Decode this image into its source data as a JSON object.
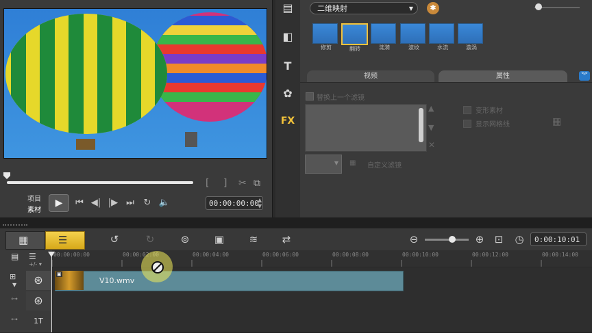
{
  "preview": {
    "timecode": "00:00:00:00",
    "mode_project": "项目",
    "mode_clip": "素材",
    "transport": [
      "play-icon",
      "home-icon",
      "prev-frame-icon",
      "next-frame-icon",
      "end-icon",
      "repeat-icon",
      "volume-icon"
    ],
    "mark_in": "[",
    "mark_out": "]"
  },
  "effects": {
    "category": "二维映射",
    "thumbs": [
      {
        "label": "修剪",
        "selected": false
      },
      {
        "label": "翻转",
        "selected": true
      },
      {
        "label": "涟漪",
        "selected": false
      },
      {
        "label": "波纹",
        "selected": false
      },
      {
        "label": "水流",
        "selected": false
      },
      {
        "label": "漩涡",
        "selected": false
      }
    ],
    "tabs": [
      "视频",
      "属性"
    ],
    "active_tab": "属性",
    "replace_last": "替换上一个滤镜",
    "option_split": "变形素材",
    "option_grid": "显示网格线",
    "custom_filter": "自定义滤镜"
  },
  "toolbar": {
    "timecode": "0:00:10:01"
  },
  "timeline": {
    "ticks": [
      "00:00:00:00",
      "00:00:02:00",
      "00:00:04:00",
      "00:00:06:00",
      "00:00:08:00",
      "00:00:10:00",
      "00:00:12:00",
      "00:00:14:00"
    ],
    "clip_name": "V10.wmv",
    "title_track_label": "1T"
  },
  "colors": {
    "accent_yellow": "#f2c23a",
    "clip_fill": "#5d8b98",
    "selected_view": "#e8bb2c"
  }
}
